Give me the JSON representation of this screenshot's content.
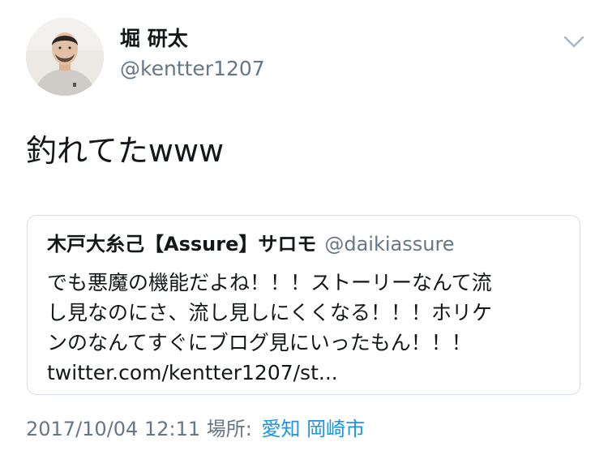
{
  "author": {
    "display_name": "堀 研太",
    "handle": "@kentter1207"
  },
  "tweet": {
    "text": "釣れてたwww"
  },
  "quoted_tweet": {
    "display_name": "木戸大糸己【Assure】サロモ",
    "handle": "@daikiassure",
    "lines": [
      "でも悪魔の機能だよね！！！ストーリーなんて流",
      "し見なのにさ、流し見しにくくなる！！！ホリケ",
      "ンのなんてすぐにブログ見にいったもん！！！",
      "twitter.com/kentter1207/st..."
    ]
  },
  "meta": {
    "timestamp": "2017/10/04 12:11",
    "location_label": "場所:",
    "location": "愛知 岡崎市"
  },
  "icons": {
    "caret": "chevron-down-icon",
    "avatar": "profile-photo"
  },
  "colors": {
    "primary_text": "#14171a",
    "secondary_text": "#657786",
    "link": "#1b95e0",
    "border": "#d5dde3"
  }
}
